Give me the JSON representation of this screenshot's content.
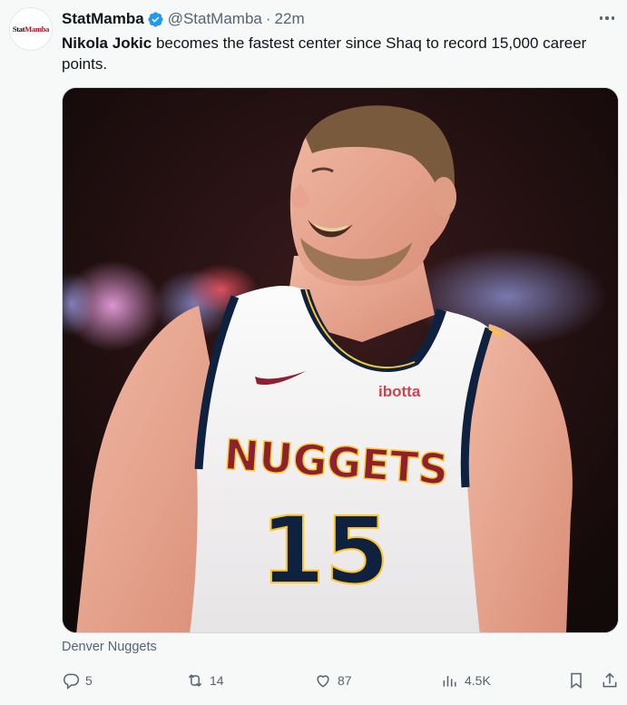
{
  "tweet": {
    "avatar": {
      "part1": "Stat",
      "part2": "Mamba"
    },
    "display_name": "StatMamba",
    "handle": "@StatMamba",
    "separator": "·",
    "time": "22m",
    "text_bold": "Nikola Jokic",
    "text_rest": " becomes the fastest center since Shaq to record 15,000 career points.",
    "media": {
      "jersey_team": "NUGGETS",
      "jersey_number": "15",
      "jersey_sponsor": "ibotta"
    },
    "media_caption": "Denver Nuggets",
    "actions": {
      "replies": "5",
      "reposts": "14",
      "likes": "87",
      "views": "4.5K"
    }
  },
  "colors": {
    "verified": "#1d9bf0",
    "jersey_gold": "#fec524",
    "jersey_red": "#8b2131",
    "jersey_navy": "#0e2240",
    "muted": "#536471"
  }
}
